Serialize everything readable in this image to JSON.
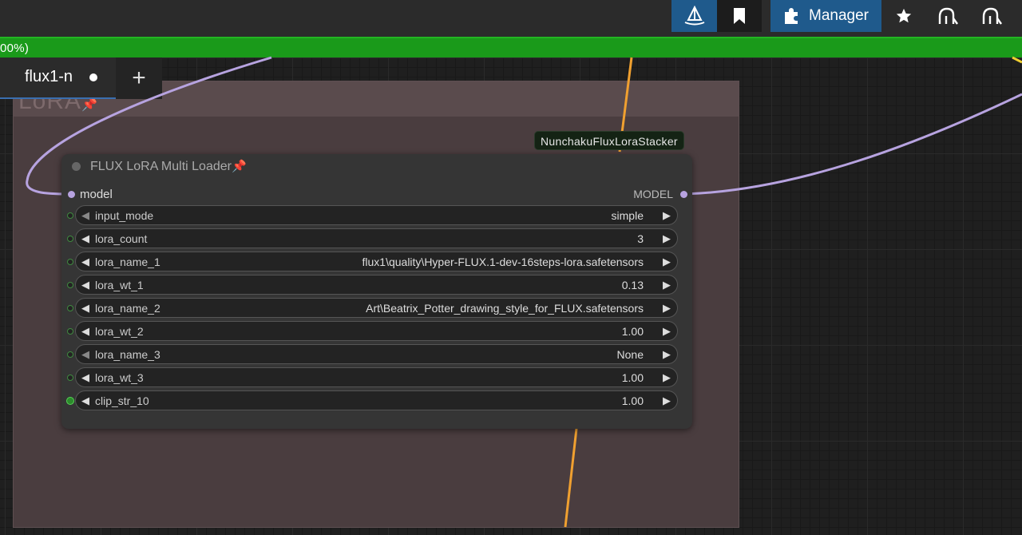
{
  "topbar": {
    "manager_label": "Manager"
  },
  "progress": {
    "text": "00%)"
  },
  "tabs": [
    {
      "label": "flux1-n",
      "unsaved": true
    }
  ],
  "tab_add_label": "+",
  "group": {
    "title": "LoRA"
  },
  "badge": {
    "label": "NunchakuFluxLoraStacker"
  },
  "node": {
    "title": "FLUX LoRA Multi Loader",
    "input_label": "model",
    "output_label": "MODEL",
    "widgets": [
      {
        "name": "input_mode",
        "value": "simple",
        "disabled_left": true
      },
      {
        "name": "lora_count",
        "value": "3",
        "disabled_left": false
      },
      {
        "name": "lora_name_1",
        "value": "flux1\\quality\\Hyper-FLUX.1-dev-16steps-lora.safetensors",
        "disabled_left": false
      },
      {
        "name": "lora_wt_1",
        "value": "0.13",
        "disabled_left": false
      },
      {
        "name": "lora_name_2",
        "value": "Art\\Beatrix_Potter_drawing_style_for_FLUX.safetensors",
        "disabled_left": false
      },
      {
        "name": "lora_wt_2",
        "value": "1.00",
        "disabled_left": false
      },
      {
        "name": "lora_name_3",
        "value": "None",
        "disabled_left": true
      },
      {
        "name": "lora_wt_3",
        "value": "1.00",
        "disabled_left": false
      },
      {
        "name": "clip_str_10",
        "value": "1.00",
        "disabled_left": false
      }
    ]
  },
  "colors": {
    "accent_blue": "#1f5a8c",
    "progress_green": "#1a9a1a",
    "model_wire": "#b7a3e0",
    "other_wire": "#f0a030",
    "group_bg": "#4a3d3f"
  }
}
